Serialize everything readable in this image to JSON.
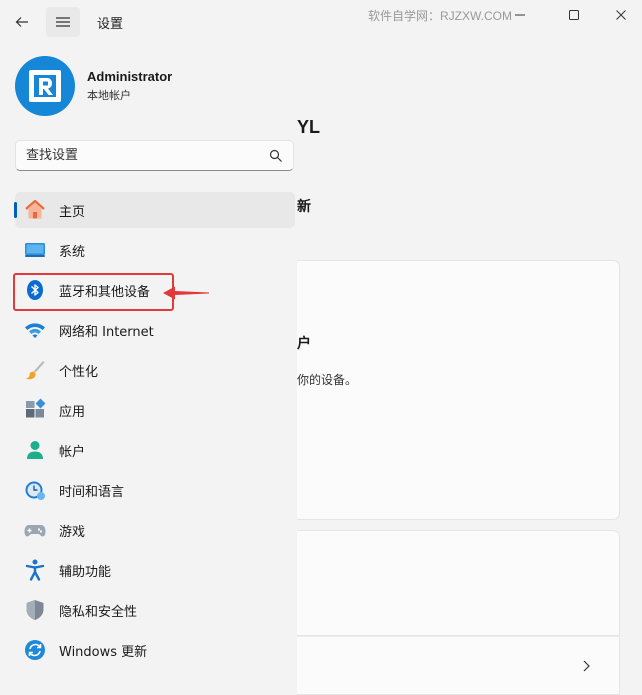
{
  "window": {
    "title": "设置",
    "watermark": "软件自学网：RJZXW.COM"
  },
  "profile": {
    "name": "Administrator",
    "account_type": "本地帐户"
  },
  "search": {
    "placeholder": "查找设置"
  },
  "sidebar": {
    "items": [
      {
        "label": "主页",
        "icon": "home-icon",
        "active": true
      },
      {
        "label": "系统",
        "icon": "system-icon"
      },
      {
        "label": "蓝牙和其他设备",
        "icon": "bluetooth-icon",
        "highlighted": true
      },
      {
        "label": "网络和 Internet",
        "icon": "wifi-icon"
      },
      {
        "label": "个性化",
        "icon": "brush-icon"
      },
      {
        "label": "应用",
        "icon": "apps-icon"
      },
      {
        "label": "帐户",
        "icon": "account-icon"
      },
      {
        "label": "时间和语言",
        "icon": "time-language-icon"
      },
      {
        "label": "游戏",
        "icon": "gamepad-icon"
      },
      {
        "label": "辅助功能",
        "icon": "accessibility-icon"
      },
      {
        "label": "隐私和安全性",
        "icon": "shield-icon"
      },
      {
        "label": "Windows 更新",
        "icon": "windows-update-icon"
      }
    ]
  },
  "main": {
    "name_fragment": "YL",
    "update_fragment": "新",
    "card_title_fragment": "户",
    "card_desc_fragment": "你的设备。"
  },
  "colors": {
    "accent": "#005fb8",
    "avatar": "#1587d6",
    "highlight": "#e23a3a"
  }
}
